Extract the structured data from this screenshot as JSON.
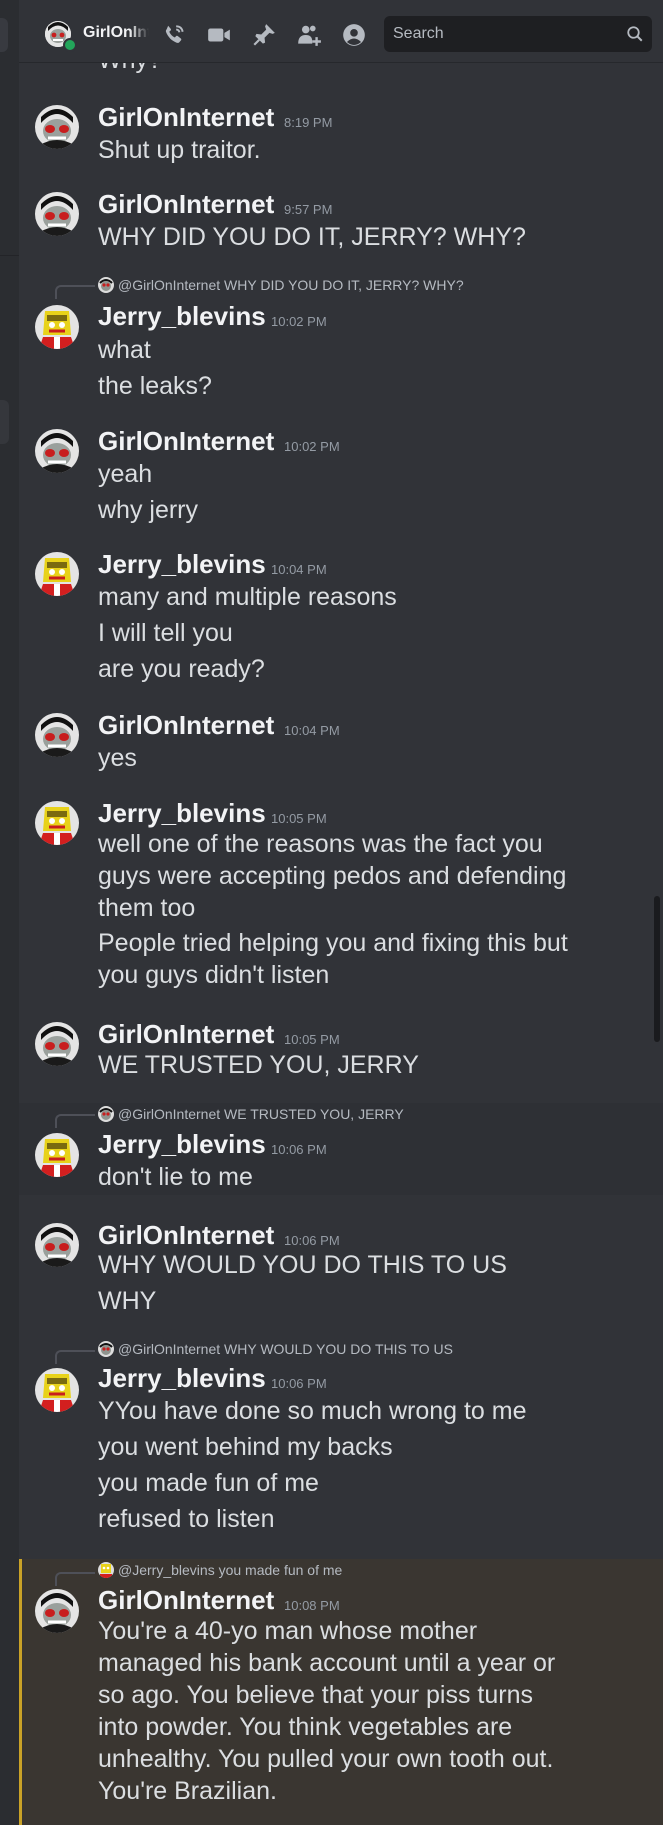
{
  "header": {
    "title": "GirlOnInternet",
    "search_placeholder": "Search",
    "icons": [
      "phone-call-icon",
      "video-call-icon",
      "pin-icon",
      "add-member-icon",
      "profile-icon",
      "search-icon"
    ]
  },
  "colors": {
    "online": "#23a55a",
    "mention_bar": "#c9a227",
    "background": "#313338",
    "sidebar": "#2b2d31"
  },
  "partial_top_text": "Why?",
  "messages": [
    {
      "author": "GirlOnInternet",
      "time": "8:19 PM",
      "lines": [
        "Shut up traitor."
      ]
    },
    {
      "author": "GirlOnInternet",
      "time": "9:57 PM",
      "lines": [
        "WHY DID YOU DO IT, JERRY? WHY?"
      ]
    },
    {
      "reply_to": "@GirlOnInternet",
      "reply_text": "WHY DID YOU DO IT, JERRY? WHY?",
      "author": "Jerry_blevins",
      "time": "10:02 PM",
      "lines": [
        "what",
        "the leaks?"
      ]
    },
    {
      "author": "GirlOnInternet",
      "time": "10:02 PM",
      "lines": [
        "yeah",
        "why jerry"
      ]
    },
    {
      "author": "Jerry_blevins",
      "time": "10:04 PM",
      "lines": [
        "many and multiple reasons",
        "I will tell you",
        "are you ready?"
      ]
    },
    {
      "author": "GirlOnInternet",
      "time": "10:04 PM",
      "lines": [
        "yes"
      ]
    },
    {
      "author": "Jerry_blevins",
      "time": "10:05 PM",
      "lines": [
        "well one of the reasons was the fact you",
        "guys were accepting pedos and defending",
        "them too",
        "People tried helping you and fixing this but",
        "you guys didn't listen"
      ]
    },
    {
      "author": "GirlOnInternet",
      "time": "10:05 PM",
      "lines": [
        "WE TRUSTED YOU, JERRY"
      ]
    },
    {
      "reply_to": "@GirlOnInternet",
      "reply_text": "WE TRUSTED YOU, JERRY",
      "author": "Jerry_blevins",
      "time": "10:06 PM",
      "lines": [
        "don't lie to me"
      ]
    },
    {
      "author": "GirlOnInternet",
      "time": "10:06 PM",
      "lines": [
        "WHY WOULD YOU DO THIS TO US",
        "WHY"
      ]
    },
    {
      "reply_to": "@GirlOnInternet",
      "reply_text": "WHY WOULD YOU DO THIS TO US",
      "author": "Jerry_blevins",
      "time": "10:06 PM",
      "lines": [
        "YYou have done so much wrong to me",
        "you went behind my backs",
        "you made fun of me",
        "refused to listen"
      ]
    },
    {
      "reply_to": "@Jerry_blevins",
      "reply_text": "you made fun of me",
      "author": "GirlOnInternet",
      "time": "10:08 PM",
      "lines": [
        "You're a 40-yo man whose mother",
        "managed his bank account until a year or",
        "so ago. You believe that your piss turns",
        "into powder. You think vegetables are",
        "unhealthy. You pulled your own tooth out.",
        "You're Brazilian."
      ]
    }
  ]
}
